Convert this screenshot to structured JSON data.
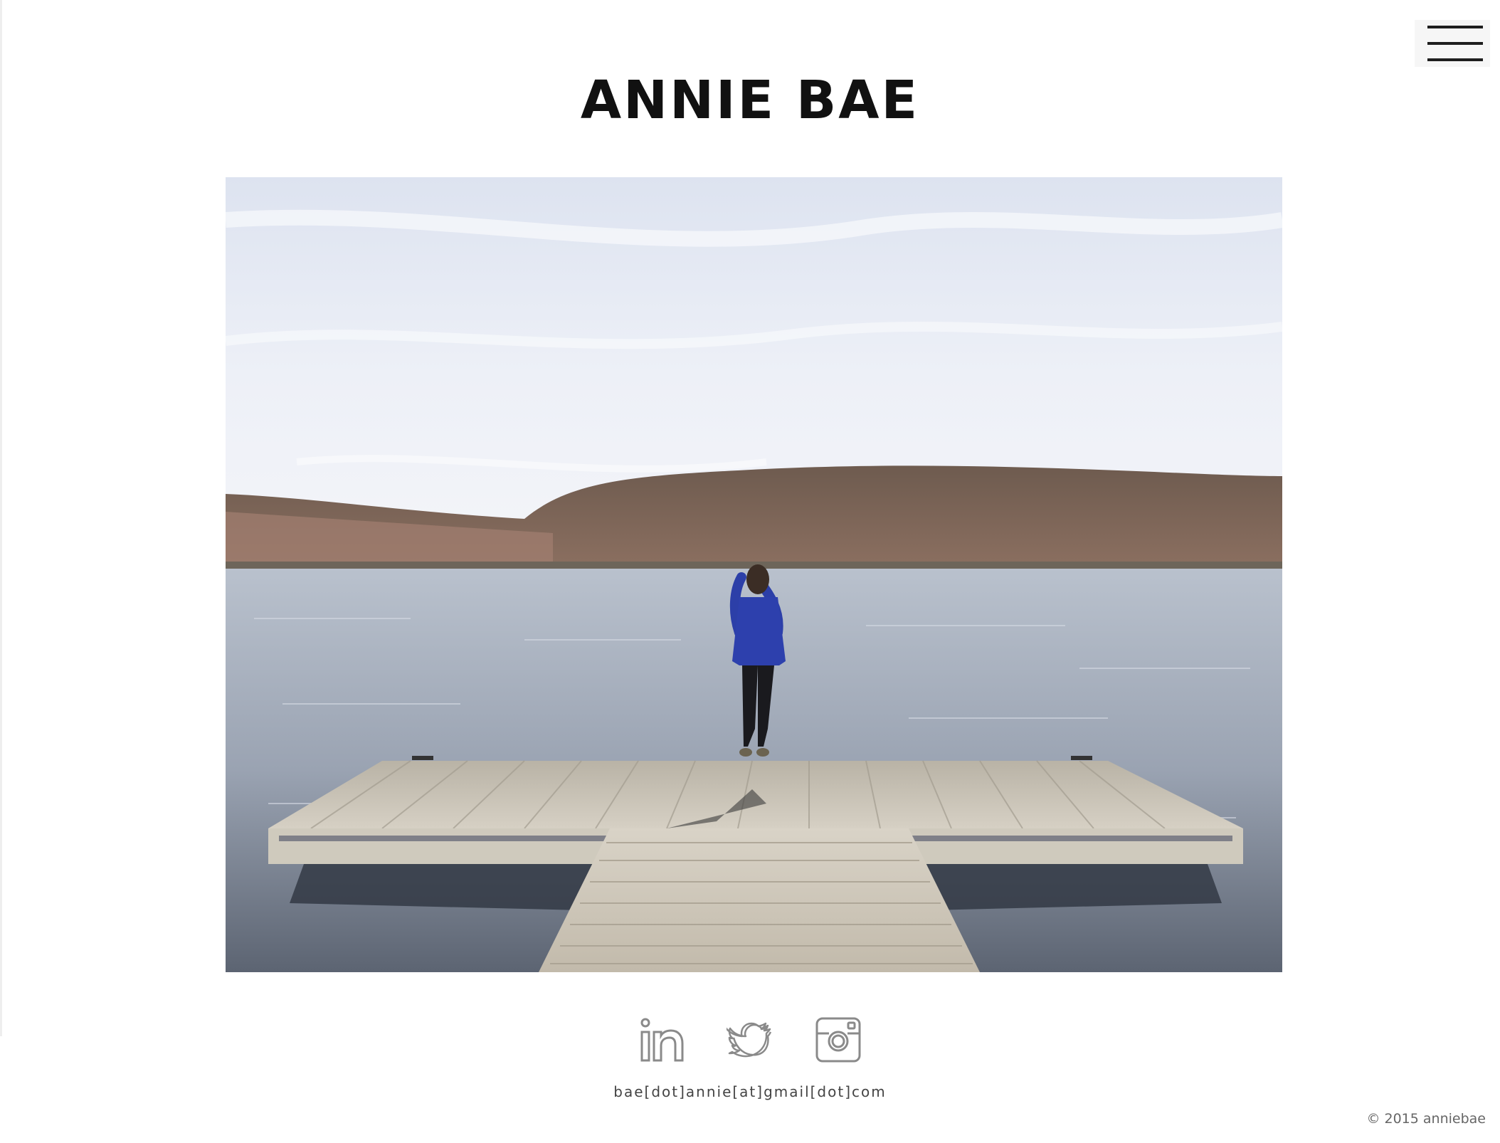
{
  "header": {
    "site_title": "ANNIE BAE",
    "menu_icon": "hamburger-menu-icon"
  },
  "hero": {
    "image_content": "photo of a person stretching on a wooden dock facing a lake with wooded hills under a pale sky"
  },
  "social": [
    {
      "name": "linkedin",
      "icon": "linkedin-icon"
    },
    {
      "name": "twitter",
      "icon": "twitter-icon"
    },
    {
      "name": "instagram",
      "icon": "instagram-icon"
    }
  ],
  "footer": {
    "email": "bae[dot]annie[at]gmail[dot]com",
    "copyright": "© 2015 anniebae"
  },
  "colors": {
    "text": "#111111",
    "icon_gray": "#8a8a8a",
    "background": "#ffffff"
  }
}
